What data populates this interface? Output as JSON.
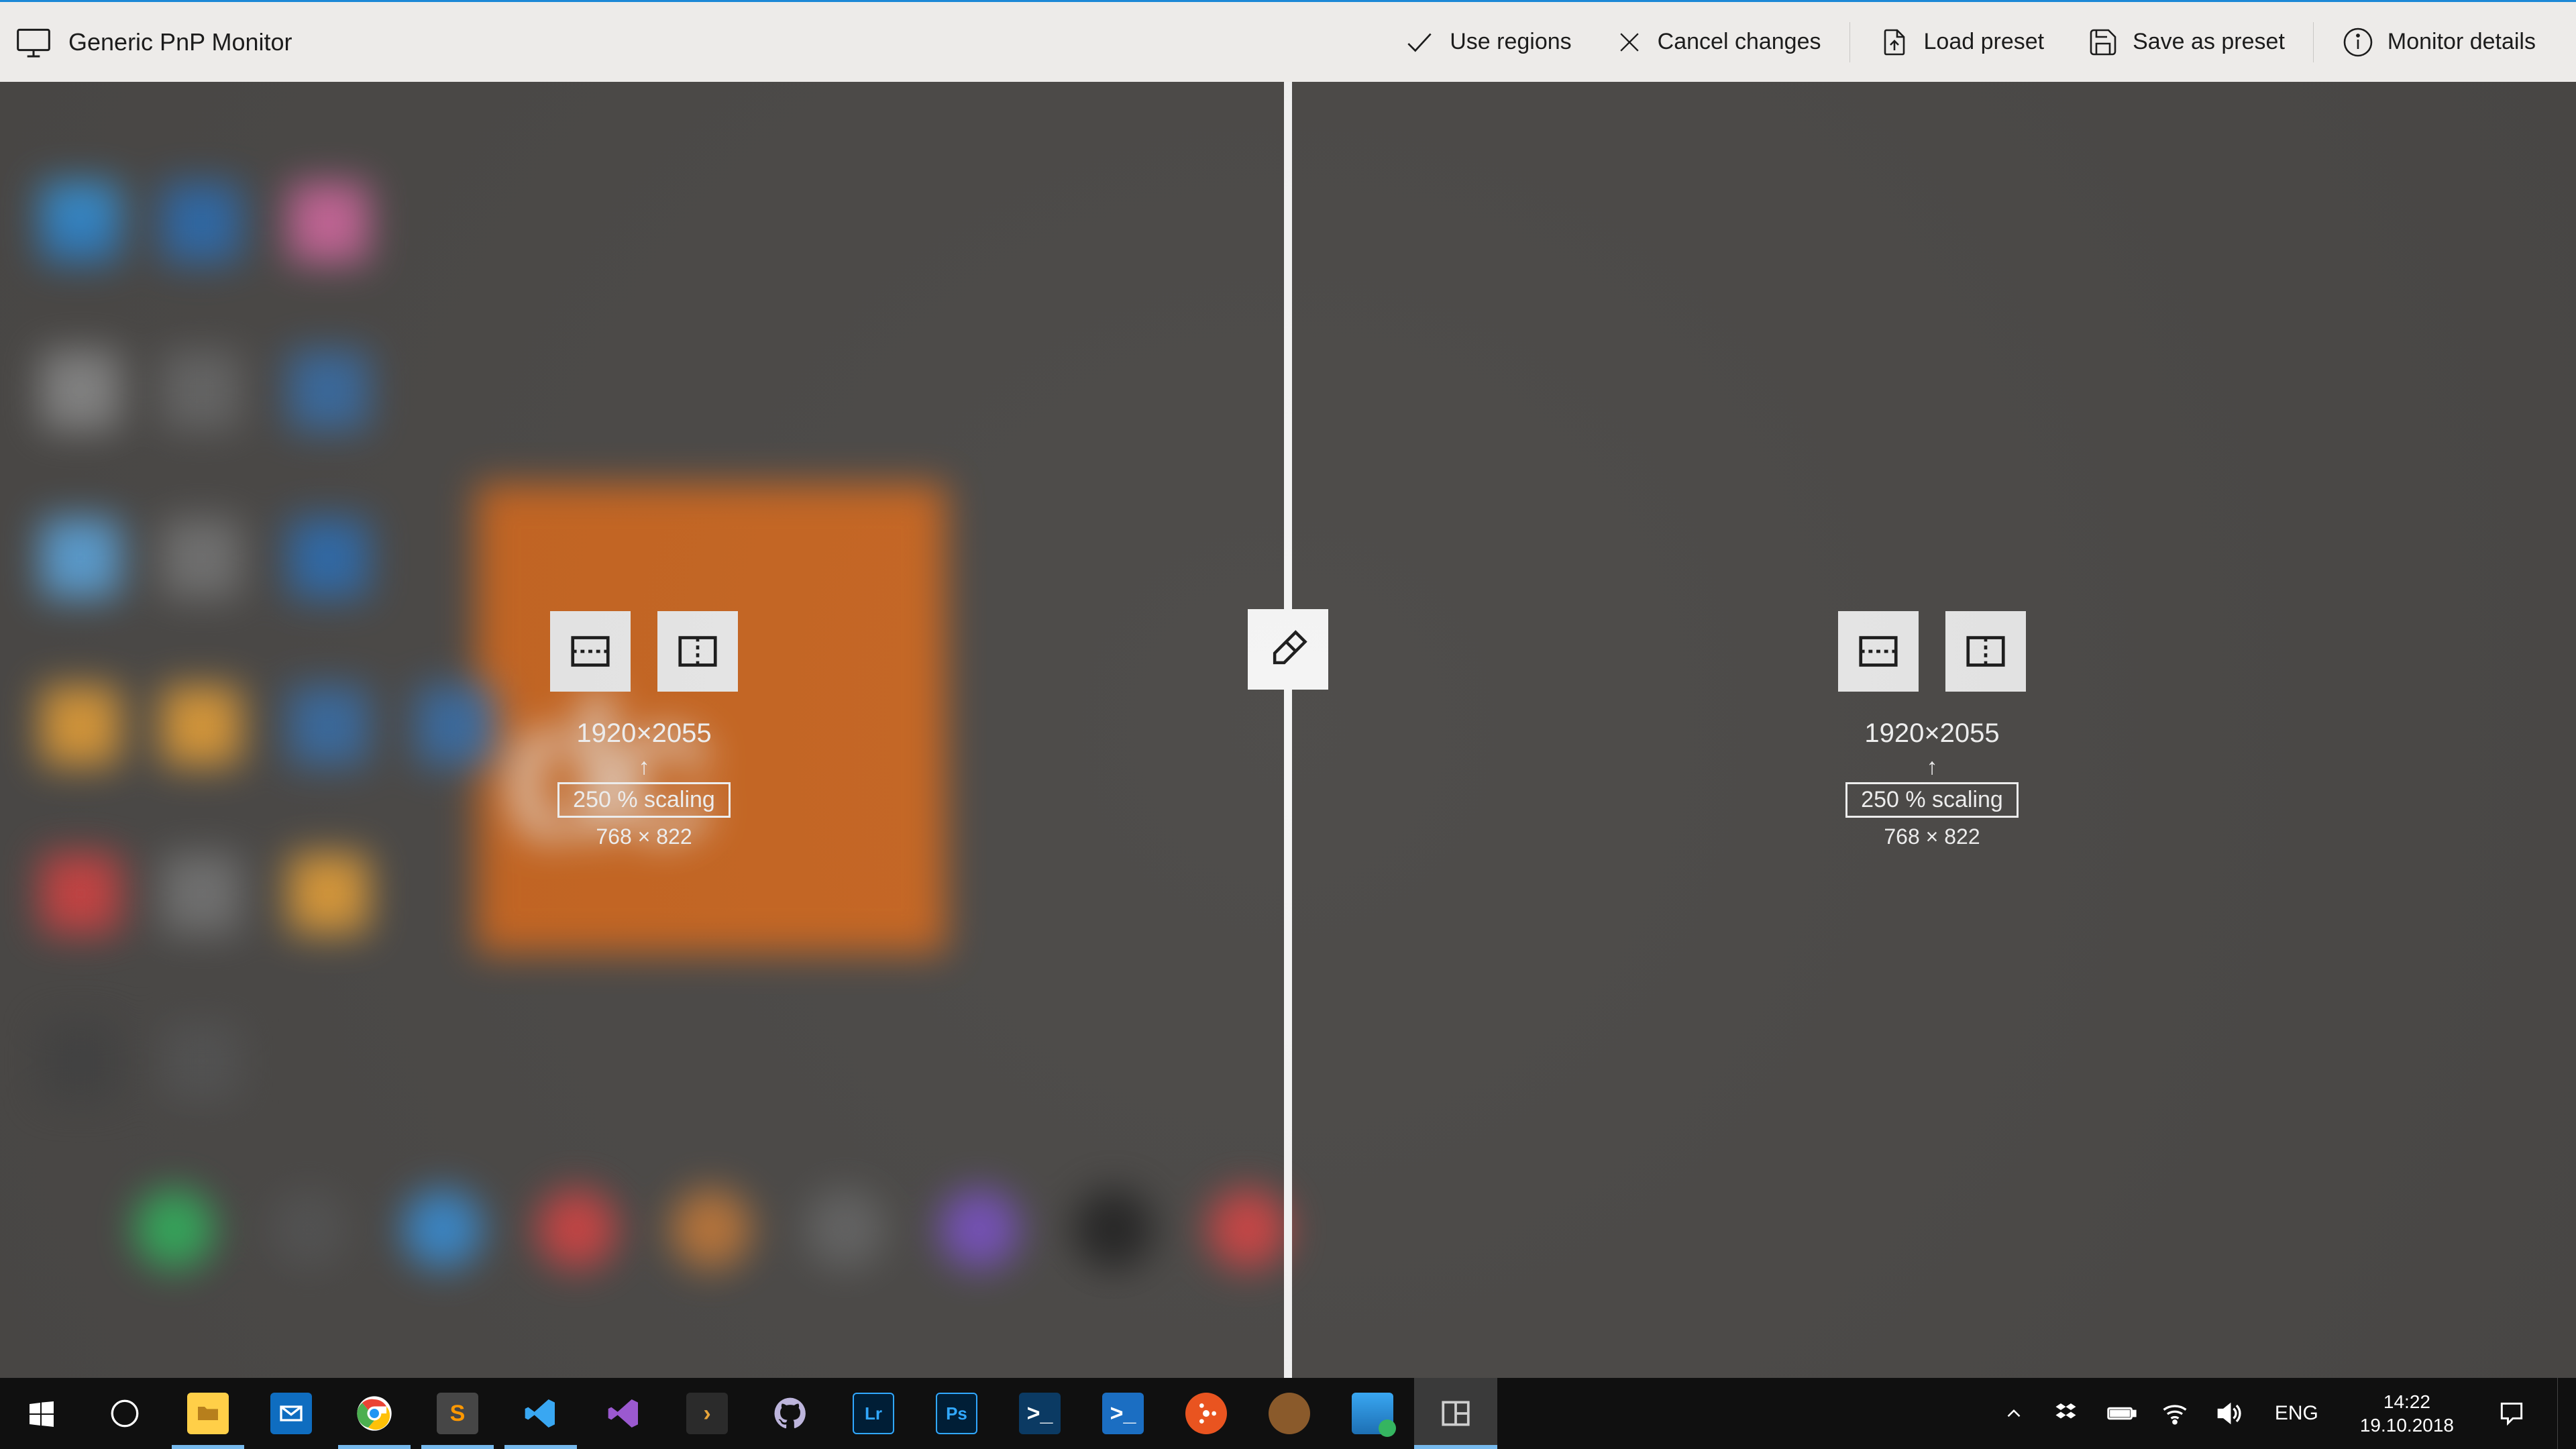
{
  "toolbar": {
    "title": "Generic PnP Monitor",
    "use_regions": "Use regions",
    "cancel_changes": "Cancel changes",
    "load_preset": "Load preset",
    "save_preset": "Save as preset",
    "monitor_details": "Monitor details"
  },
  "regions": {
    "left": {
      "resolution": "1920×2055",
      "scaling": "250 % scaling",
      "scaled_resolution": "768 × 822"
    },
    "right": {
      "resolution": "1920×2055",
      "scaling": "250 % scaling",
      "scaled_resolution": "768 × 822"
    }
  },
  "taskbar": {
    "lang": "ENG",
    "time": "14:22",
    "date": "19.10.2018"
  }
}
